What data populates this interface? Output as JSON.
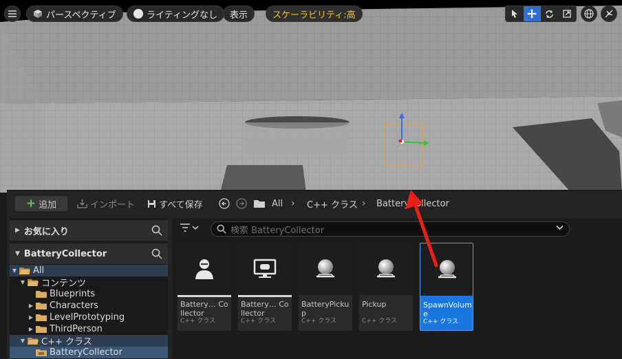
{
  "viewport": {
    "toolbar": {
      "menu_icon": "hamburger-icon",
      "perspective_label": "パースペクティブ",
      "lighting_label": "ライティングなし",
      "show_label": "表示",
      "scalability_label": "スケーラビリティ:高",
      "tools": [
        "select-icon",
        "move-icon",
        "rotate-icon",
        "scale-icon"
      ],
      "active_tool": "move-icon",
      "extra_icons": [
        "globe-icon",
        "snap-icon"
      ]
    },
    "accent_color": "#2f6fd6",
    "scalability_color": "#f2c230"
  },
  "content_browser": {
    "toolbar": {
      "add_label": "追加",
      "import_label": "インポート",
      "save_all_label": "すべて保存",
      "breadcrumbs": [
        "All",
        "C++ クラス",
        "BatteryCollector"
      ]
    },
    "left_panel": {
      "favorites_label": "お気に入り",
      "project_label": "BatteryCollector",
      "tree": [
        {
          "label": "All",
          "depth": 0,
          "expanded": true
        },
        {
          "label": "コンテンツ",
          "depth": 1,
          "expanded": true
        },
        {
          "label": "Blueprints",
          "depth": 2,
          "expanded": false,
          "has_children": false
        },
        {
          "label": "Characters",
          "depth": 2,
          "expanded": false,
          "has_children": true
        },
        {
          "label": "LevelPrototyping",
          "depth": 2,
          "expanded": false,
          "has_children": true
        },
        {
          "label": "ThirdPerson",
          "depth": 2,
          "expanded": false,
          "has_children": true
        },
        {
          "label": "C++ クラス",
          "depth": 1,
          "expanded": true
        },
        {
          "label": "BatteryCollector",
          "depth": 2,
          "expanded": false,
          "has_children": false,
          "selected": true
        }
      ]
    },
    "right_panel": {
      "search_placeholder": "検索 BatteryCollector",
      "assets": [
        {
          "name": "Battery… Collector",
          "type": "C++ クラス",
          "icon": "character-icon"
        },
        {
          "name": "Battery… Collector",
          "type": "C++ クラス",
          "icon": "gamemode-icon"
        },
        {
          "name": "BatteryPickup",
          "type": "C++ クラス",
          "icon": "actor-icon"
        },
        {
          "name": "Pickup",
          "type": "C++ クラス",
          "icon": "actor-icon"
        },
        {
          "name": "SpawnVolume",
          "type": "C++ クラス",
          "icon": "actor-icon",
          "selected": true
        }
      ]
    }
  },
  "annotation": {
    "color": "#e8201a"
  }
}
